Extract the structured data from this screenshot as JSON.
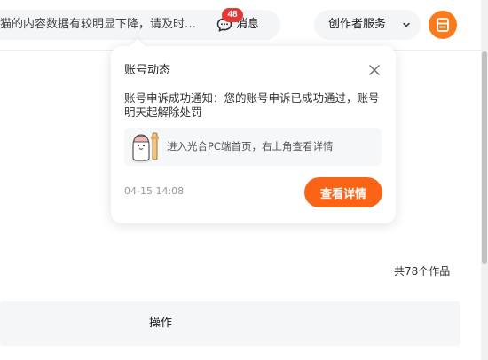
{
  "topbar": {
    "notice_text": "猫的内容数据有较明显下降，请及时…",
    "messages": {
      "label": "消息",
      "badge_count": "48",
      "icon": "message-bubble-icon"
    },
    "creator_menu": {
      "label": "创作者服务",
      "icon": "chevron-down-icon"
    },
    "avatar": {
      "icon": "document-stack-icon",
      "color": "#fa7a1c"
    }
  },
  "popup": {
    "title": "账号动态",
    "close_icon": "close-icon",
    "body": "账号申诉成功通知：您的账号申诉已成功通过，账号明天起解除处罚",
    "guide_text": "进入光合PC端首页，右上角查看详情",
    "time": "04-15 14:08",
    "detail_button": "查看详情"
  },
  "content": {
    "total_count": "共78个作品",
    "table_columns": [
      "操作"
    ]
  },
  "colors": {
    "accent": "#fa6417",
    "badge": "#e53935",
    "pill_bg": "#f4f5f7"
  }
}
